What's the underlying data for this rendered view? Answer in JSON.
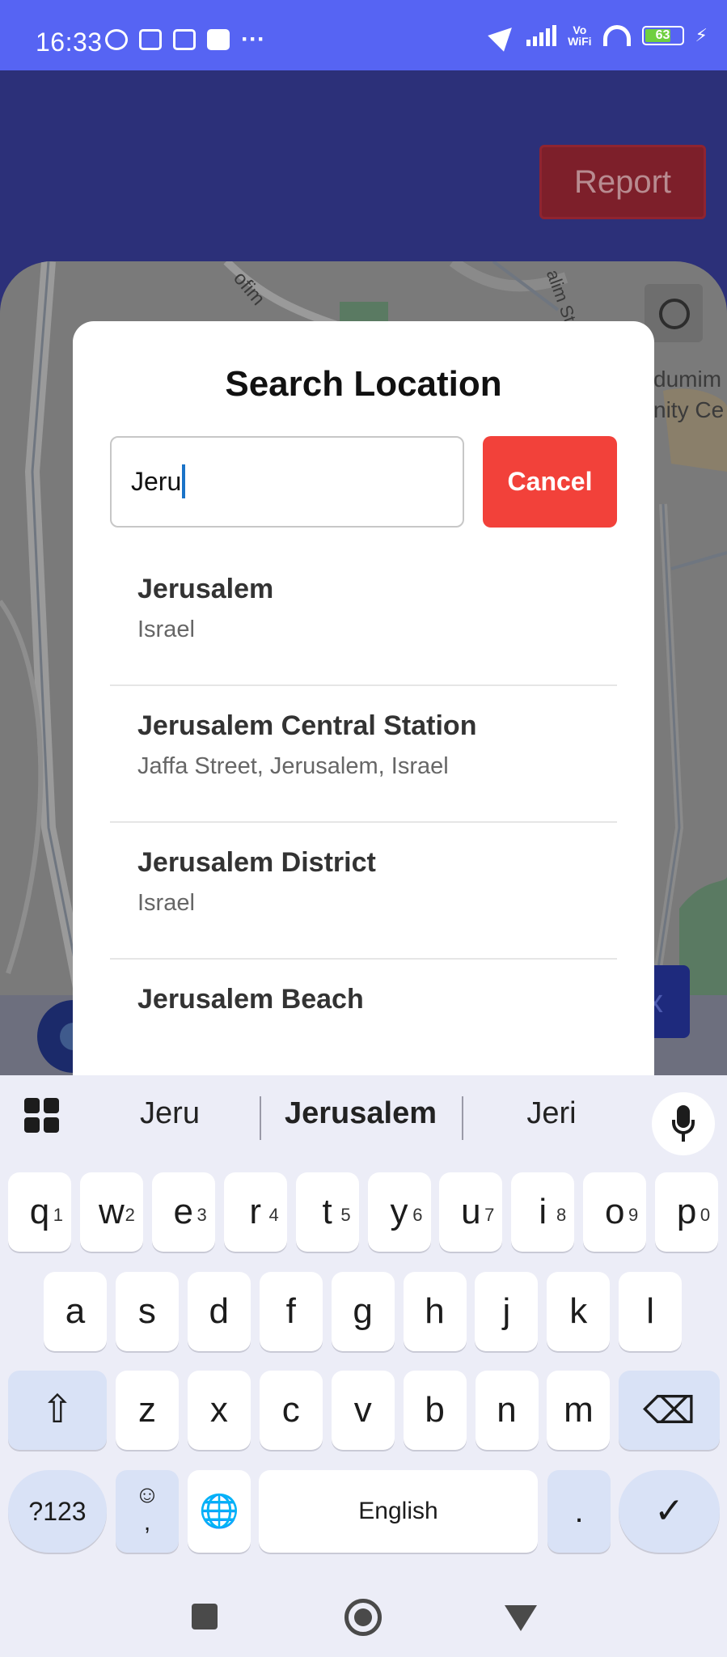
{
  "status_bar": {
    "time": "16:33",
    "battery": "63",
    "vowifi_top": "Vo",
    "vowifi_bottom": "WiFi",
    "more": "···"
  },
  "header": {
    "report_label": "Report"
  },
  "map": {
    "label_top_left": "ofim",
    "label_top_right": "alim St",
    "label_right_1": "dumim",
    "label_right_2": "nity Ce"
  },
  "modal": {
    "title": "Search Location",
    "search_value": "Jeru",
    "cancel_label": "Cancel",
    "results": [
      {
        "name": "Jerusalem",
        "sub": "Israel"
      },
      {
        "name": "Jerusalem Central Station",
        "sub": "Jaffa Street, Jerusalem, Israel"
      },
      {
        "name": "Jerusalem District",
        "sub": "Israel"
      },
      {
        "name": "Jerusalem Beach",
        "sub": ""
      }
    ]
  },
  "bottom_right_glyph": "x",
  "keyboard": {
    "suggestions": [
      "Jeru",
      "Jerusalem",
      "Jeri"
    ],
    "row1": [
      {
        "k": "q",
        "h": "1"
      },
      {
        "k": "w",
        "h": "2"
      },
      {
        "k": "e",
        "h": "3"
      },
      {
        "k": "r",
        "h": "4"
      },
      {
        "k": "t",
        "h": "5"
      },
      {
        "k": "y",
        "h": "6"
      },
      {
        "k": "u",
        "h": "7"
      },
      {
        "k": "i",
        "h": "8"
      },
      {
        "k": "o",
        "h": "9"
      },
      {
        "k": "p",
        "h": "0"
      }
    ],
    "row2": [
      "a",
      "s",
      "d",
      "f",
      "g",
      "h",
      "j",
      "k",
      "l"
    ],
    "row3": [
      "z",
      "x",
      "c",
      "v",
      "b",
      "n",
      "m"
    ],
    "symbols_label": "?123",
    "emoji_glyph": "☺",
    "comma": ",",
    "space_label": "English",
    "period": ".",
    "enter_glyph": "✓",
    "shift_glyph": "⇧",
    "backspace_glyph": "⌫",
    "globe_glyph": "🌐"
  }
}
